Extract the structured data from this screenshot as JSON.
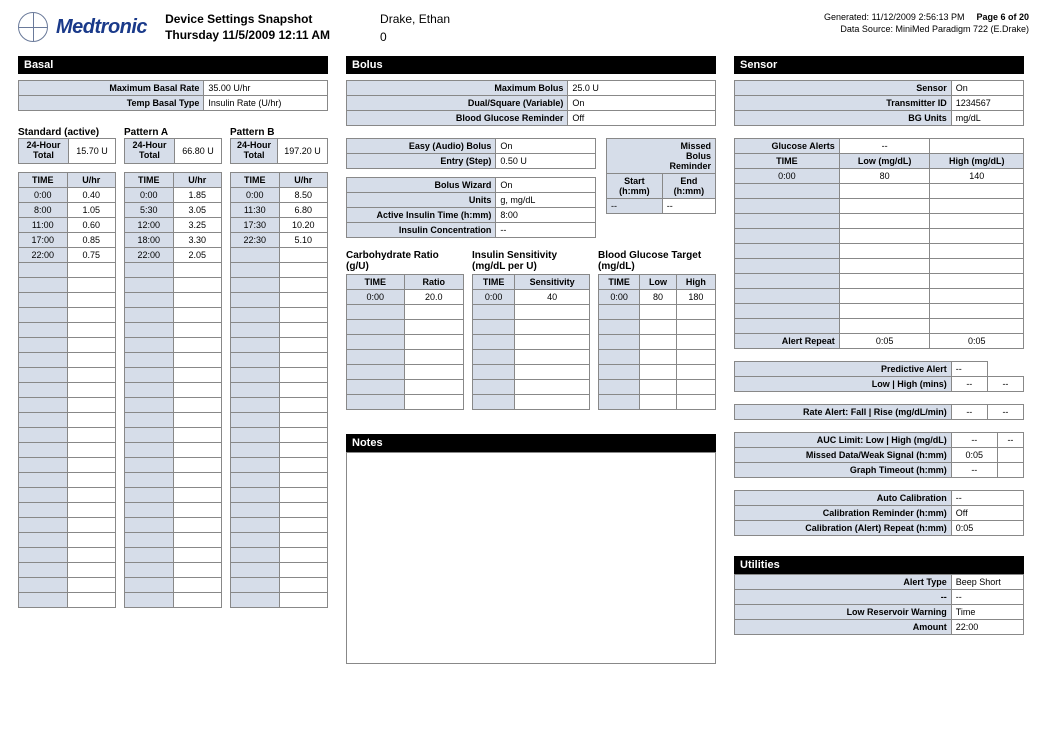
{
  "header": {
    "brand": "Medtronic",
    "title": "Device Settings Snapshot",
    "datetime": "Thursday 11/5/2009 12:11 AM",
    "patient": "Drake, Ethan",
    "zero": "0",
    "generated": "Generated: 11/12/2009 2:56:13 PM",
    "page": "Page 6 of 20",
    "source": "Data Source: MiniMed Paradigm 722 (E.Drake)"
  },
  "basal": {
    "title": "Basal",
    "maxRateLbl": "Maximum Basal Rate",
    "maxRate": "35.00 U/hr",
    "tempTypeLbl": "Temp Basal Type",
    "tempType": "Insulin Rate (U/hr)",
    "hdrTime": "TIME",
    "hdrU": "U/hr",
    "totLbl": "24-Hour\nTotal",
    "patterns": [
      {
        "name": "Standard (active)",
        "total": "15.70 U",
        "rows": [
          [
            "0:00",
            "0.40"
          ],
          [
            "8:00",
            "1.05"
          ],
          [
            "11:00",
            "0.60"
          ],
          [
            "17:00",
            "0.85"
          ],
          [
            "22:00",
            "0.75"
          ]
        ]
      },
      {
        "name": "Pattern A",
        "total": "66.80 U",
        "rows": [
          [
            "0:00",
            "1.85"
          ],
          [
            "5:30",
            "3.05"
          ],
          [
            "12:00",
            "3.25"
          ],
          [
            "18:00",
            "3.30"
          ],
          [
            "22:00",
            "2.05"
          ]
        ]
      },
      {
        "name": "Pattern B",
        "total": "197.20 U",
        "rows": [
          [
            "0:00",
            "8.50"
          ],
          [
            "11:30",
            "6.80"
          ],
          [
            "17:30",
            "10.20"
          ],
          [
            "22:30",
            "5.10"
          ]
        ]
      }
    ]
  },
  "bolus": {
    "title": "Bolus",
    "kv1": [
      [
        "Maximum Bolus",
        "25.0 U"
      ],
      [
        "Dual/Square (Variable)",
        "On"
      ],
      [
        "Blood Glucose Reminder",
        "Off"
      ]
    ],
    "kv2": [
      [
        "Easy (Audio) Bolus",
        "On"
      ],
      [
        "Entry (Step)",
        "0.50 U"
      ]
    ],
    "kv3": [
      [
        "Bolus Wizard",
        "On"
      ],
      [
        "Units",
        "g, mg/dL"
      ],
      [
        "Active Insulin Time (h:mm)",
        "8:00"
      ],
      [
        "Insulin Concentration",
        "--"
      ]
    ],
    "missed": {
      "title": "Missed\nBolus\nReminder",
      "h1": "Start (h:mm)",
      "h2": "End (h:mm)",
      "v1": "--",
      "v2": "--"
    },
    "carb": {
      "title": "Carbohydrate Ratio (g/U)",
      "h1": "TIME",
      "h2": "Ratio",
      "rows": [
        [
          "0:00",
          "20.0"
        ]
      ]
    },
    "sens": {
      "title": "Insulin Sensitivity (mg/dL per U)",
      "h1": "TIME",
      "h2": "Sensitivity",
      "rows": [
        [
          "0:00",
          "40"
        ]
      ]
    },
    "bgt": {
      "title": "Blood Glucose Target (mg/dL)",
      "h1": "TIME",
      "h2": "Low",
      "h3": "High",
      "rows": [
        [
          "0:00",
          "80",
          "180"
        ]
      ]
    }
  },
  "notes": {
    "title": "Notes"
  },
  "sensor": {
    "title": "Sensor",
    "kv": [
      [
        "Sensor",
        "On"
      ],
      [
        "Transmitter ID",
        "1234567"
      ],
      [
        "BG Units",
        "mg/dL"
      ]
    ],
    "glucose": {
      "alertsLbl": "Glucose Alerts",
      "alerts": "--",
      "hTime": "TIME",
      "hLow": "Low (mg/dL)",
      "hHigh": "High (mg/dL)",
      "rows": [
        [
          "0:00",
          "80",
          "140"
        ]
      ],
      "repeatLbl": "Alert Repeat",
      "r1": "0:05",
      "r2": "0:05"
    },
    "pred": [
      [
        "Predictive Alert",
        "--"
      ],
      [
        "Low | High (mins)",
        "--",
        "--"
      ]
    ],
    "rate": [
      [
        "Rate Alert: Fall | Rise (mg/dL/min)",
        "--",
        "--"
      ]
    ],
    "auc": [
      [
        "AUC Limit: Low | High (mg/dL)",
        "--",
        "--"
      ],
      [
        "Missed Data/Weak Signal (h:mm)",
        "0:05",
        ""
      ],
      [
        "Graph Timeout (h:mm)",
        "--",
        ""
      ]
    ],
    "cal": [
      [
        "Auto Calibration",
        "--"
      ],
      [
        "Calibration Reminder (h:mm)",
        "Off"
      ],
      [
        "Calibration (Alert) Repeat (h:mm)",
        "0:05"
      ]
    ]
  },
  "util": {
    "title": "Utilities",
    "kv": [
      [
        "Alert Type",
        "Beep Short"
      ],
      [
        "--",
        "--"
      ],
      [
        "Low Reservoir Warning",
        "Time"
      ],
      [
        "Amount",
        "22:00"
      ]
    ]
  }
}
